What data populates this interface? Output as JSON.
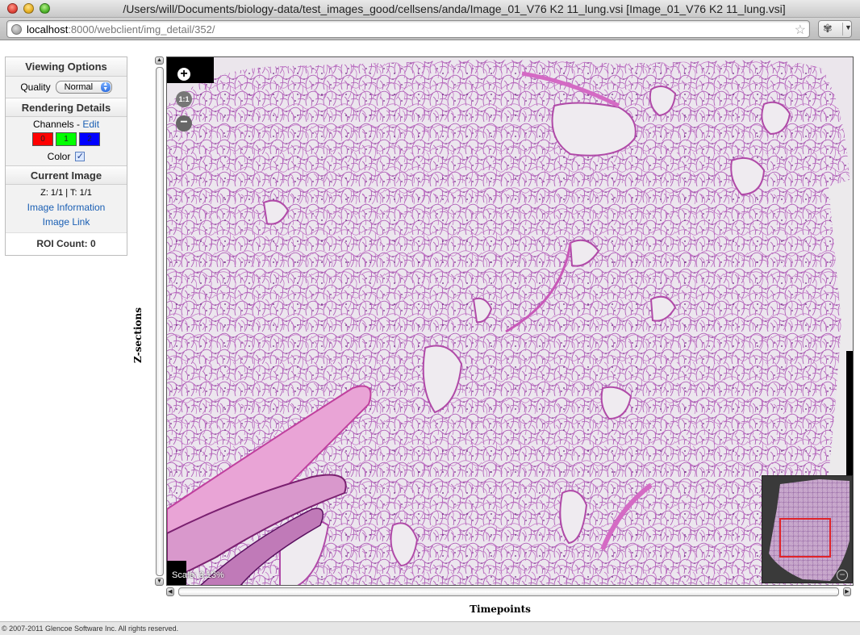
{
  "window": {
    "title": "/Users/will/Documents/biology-data/test_images_good/cellsens/anda/Image_01_V76 K2 11_lung.vsi [Image_01_V76 K2 11_lung.vsi]"
  },
  "browser": {
    "url_host": "localhost",
    "url_rest": ":8000/webclient/img_detail/352/",
    "bookmark_icon": "star-icon",
    "menu_icon": "gear-icon"
  },
  "panel": {
    "viewing_options": "Viewing Options",
    "quality_label": "Quality",
    "quality_value": "Normal",
    "rendering_details": "Rendering Details",
    "channels_label": "Channels - ",
    "channels_edit": "Edit",
    "channels": [
      {
        "label": "0",
        "color": "#ff0000"
      },
      {
        "label": "1",
        "color": "#00ff00"
      },
      {
        "label": "2",
        "color": "#0000ff"
      }
    ],
    "color_label": "Color",
    "color_checked": true,
    "current_image": "Current Image",
    "zt_text": "Z: 1/1 | T: 1/1",
    "image_information": "Image Information",
    "image_link": "Image Link",
    "roi_count": "ROI Count: 0"
  },
  "viewer": {
    "z_label": "Z-sections",
    "t_label": "Timepoints",
    "scale_text": "Scale: 3.13%",
    "zoom_in": "+",
    "zoom_one": "1:1",
    "zoom_out": "−",
    "overview_close": "−"
  },
  "footer": {
    "copyright": "© 2007-2011 Glencoe Software Inc. All rights reserved."
  }
}
